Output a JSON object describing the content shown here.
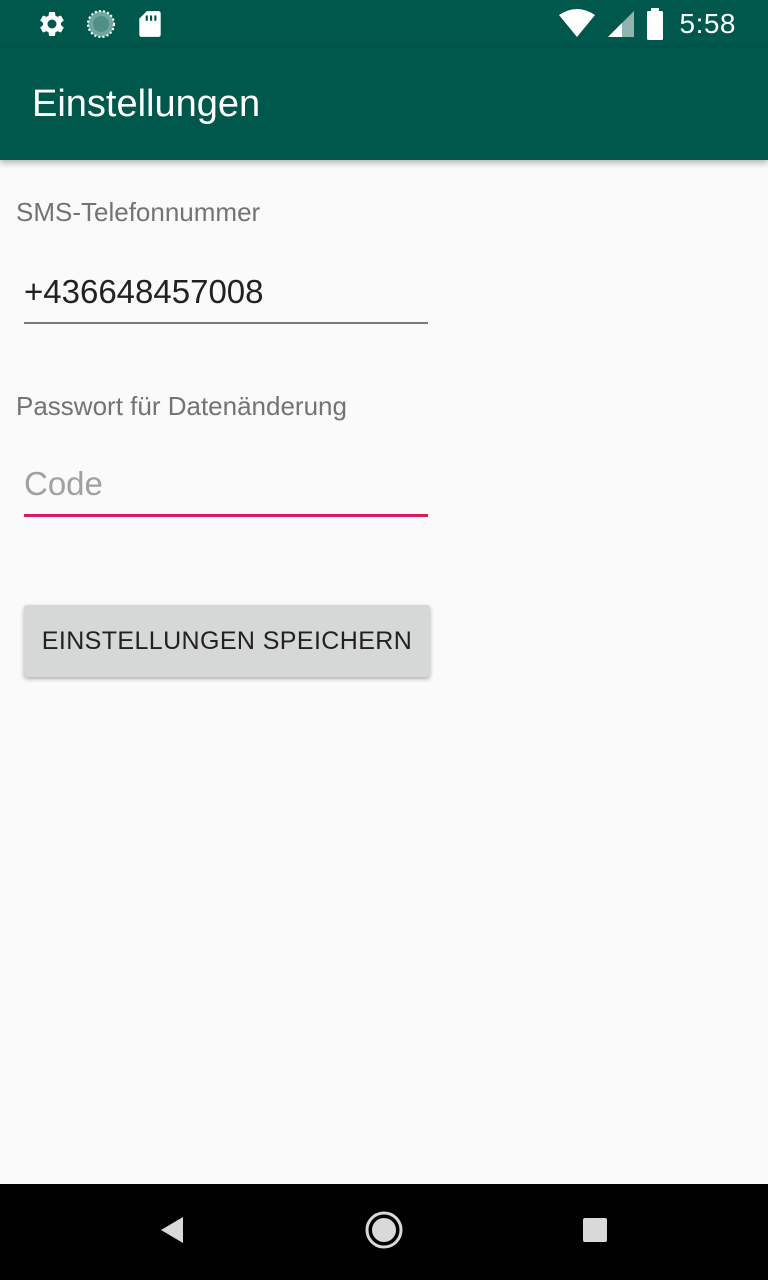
{
  "status_bar": {
    "time": "5:58",
    "left_icons": [
      "gear-icon",
      "sync-progress-icon",
      "sd-card-icon"
    ],
    "right_icons": [
      "wifi-icon",
      "cell-signal-icon",
      "battery-icon"
    ]
  },
  "app_bar": {
    "title": "Einstellungen"
  },
  "form": {
    "phone_label": "SMS-Telefonnummer",
    "phone_value": "+436648457008",
    "password_label": "Passwort für Datenänderung",
    "code_placeholder": "Code",
    "code_value": "",
    "save_label": "EINSTELLUNGEN SPEICHERN"
  },
  "nav_bar": {
    "icons": [
      "back-icon",
      "home-icon",
      "recents-icon"
    ]
  },
  "colors": {
    "primary_dark": "#00574b",
    "accent": "#d81b60",
    "background": "#fafafa",
    "button": "#d6d7d7"
  }
}
